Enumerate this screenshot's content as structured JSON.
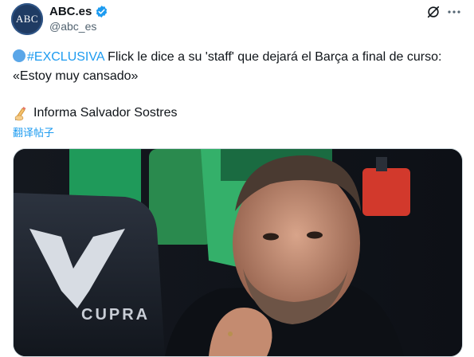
{
  "author": {
    "avatar_text": "ABC",
    "name": "ABC.es",
    "handle": "@abc_es",
    "verified": true
  },
  "header_icons": [
    "grok-icon",
    "more-icon"
  ],
  "tweet": {
    "hashtag": "#EXCLUSIVA",
    "text_rest": " Flick le dice a su 'staff' que dejará el Barça a final de curso: «Estoy muy cansado»",
    "byline": "Informa Salvador Sostres",
    "translate_label": "翻译帖子"
  },
  "media": {
    "description_icon": "photo",
    "seat_brand": "CUPRA"
  },
  "colors": {
    "accent": "#1d9bf0",
    "text": "#0f1419",
    "secondary": "#536471",
    "avatar_bg": "#1f3b63"
  }
}
